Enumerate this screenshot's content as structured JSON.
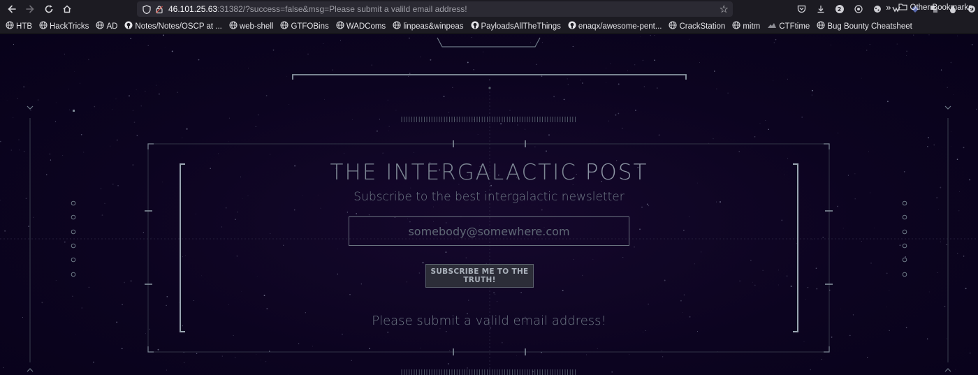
{
  "browser": {
    "url_host": "46.101.25.63",
    "url_rest": ":31382/?success=false&msg=Please submit a valild email address!",
    "icons": [
      "back-icon",
      "forward-icon",
      "reload-icon",
      "home-icon",
      "shield-icon",
      "lock-icon",
      "star-icon"
    ],
    "toolbar_badge": "2"
  },
  "bookmarks": [
    {
      "label": "HTB",
      "icon": "globe-icon"
    },
    {
      "label": "HackTricks",
      "icon": "globe-icon"
    },
    {
      "label": "AD",
      "icon": "globe-icon"
    },
    {
      "label": "Notes/Notes/OSCP at ...",
      "icon": "github-icon"
    },
    {
      "label": "web-shell",
      "icon": "globe-icon"
    },
    {
      "label": "GTFOBins",
      "icon": "globe-icon"
    },
    {
      "label": "WADComs",
      "icon": "globe-icon"
    },
    {
      "label": "linpeas&winpeas",
      "icon": "globe-icon"
    },
    {
      "label": "PayloadsAllTheThings",
      "icon": "github-icon"
    },
    {
      "label": "enaqx/awesome-pent...",
      "icon": "github-icon"
    },
    {
      "label": "CrackStation",
      "icon": "globe-icon"
    },
    {
      "label": "mitm",
      "icon": "globe-icon"
    },
    {
      "label": "CTFtime",
      "icon": "ctftime-icon"
    },
    {
      "label": "Bug Bounty Cheatsheet",
      "icon": "globe-icon"
    }
  ],
  "bookmarks_right": {
    "label": "Other Bookmarks"
  },
  "page": {
    "title_part1": "THE INTERGALACTIC",
    "title_part2": "POST",
    "subtitle": "Subscribe to the best intergalactic newsletter",
    "email_placeholder": "somebody@somewhere.com",
    "submit_label": "SUBSCRIBE ME TO THE TRUTH!",
    "message": "Please submit a valild email address!"
  },
  "colors": {
    "background": "#0c0420",
    "hud_line": "#6d7a86",
    "text": "#7d8794"
  }
}
